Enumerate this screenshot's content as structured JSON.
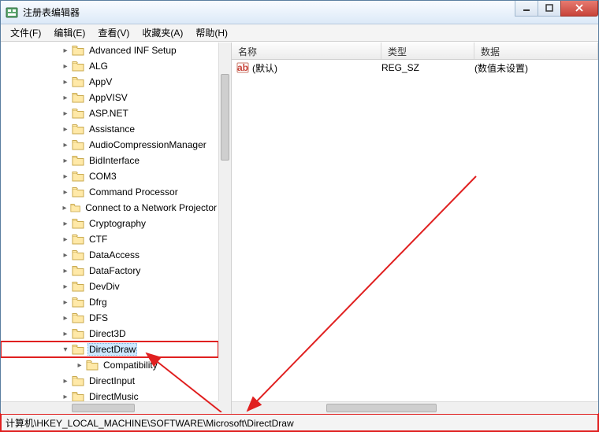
{
  "window": {
    "title": "注册表编辑器"
  },
  "menu": {
    "file": "文件(F)",
    "edit": "编辑(E)",
    "view": "查看(V)",
    "favorites": "收藏夹(A)",
    "help": "帮助(H)"
  },
  "tree": {
    "indent_base": 76,
    "items": [
      {
        "label": "Advanced INF Setup",
        "depth": 0,
        "expander": "right"
      },
      {
        "label": "ALG",
        "depth": 0,
        "expander": "right"
      },
      {
        "label": "AppV",
        "depth": 0,
        "expander": "right"
      },
      {
        "label": "AppVISV",
        "depth": 0,
        "expander": "right"
      },
      {
        "label": "ASP.NET",
        "depth": 0,
        "expander": "right"
      },
      {
        "label": "Assistance",
        "depth": 0,
        "expander": "right"
      },
      {
        "label": "AudioCompressionManager",
        "depth": 0,
        "expander": "right"
      },
      {
        "label": "BidInterface",
        "depth": 0,
        "expander": "right"
      },
      {
        "label": "COM3",
        "depth": 0,
        "expander": "right"
      },
      {
        "label": "Command Processor",
        "depth": 0,
        "expander": "right"
      },
      {
        "label": "Connect to a Network Projector",
        "depth": 0,
        "expander": "right"
      },
      {
        "label": "Cryptography",
        "depth": 0,
        "expander": "right"
      },
      {
        "label": "CTF",
        "depth": 0,
        "expander": "right"
      },
      {
        "label": "DataAccess",
        "depth": 0,
        "expander": "right"
      },
      {
        "label": "DataFactory",
        "depth": 0,
        "expander": "right"
      },
      {
        "label": "DevDiv",
        "depth": 0,
        "expander": "right"
      },
      {
        "label": "Dfrg",
        "depth": 0,
        "expander": "right"
      },
      {
        "label": "DFS",
        "depth": 0,
        "expander": "right"
      },
      {
        "label": "Direct3D",
        "depth": 0,
        "expander": "right"
      },
      {
        "label": "DirectDraw",
        "depth": 0,
        "expander": "down",
        "selected": true,
        "highlight": true
      },
      {
        "label": "Compatibility",
        "depth": 1,
        "expander": "right"
      },
      {
        "label": "DirectInput",
        "depth": 0,
        "expander": "right"
      },
      {
        "label": "DirectMusic",
        "depth": 0,
        "expander": "right"
      }
    ]
  },
  "list": {
    "columns": {
      "name": "名称",
      "type": "类型",
      "data": "数据"
    },
    "col_widths": {
      "name": 190,
      "type": 118,
      "data": 150
    },
    "rows": [
      {
        "name": "(默认)",
        "type": "REG_SZ",
        "data": "(数值未设置)"
      }
    ]
  },
  "statusbar": {
    "path": "计算机\\HKEY_LOCAL_MACHINE\\SOFTWARE\\Microsoft\\DirectDraw"
  }
}
